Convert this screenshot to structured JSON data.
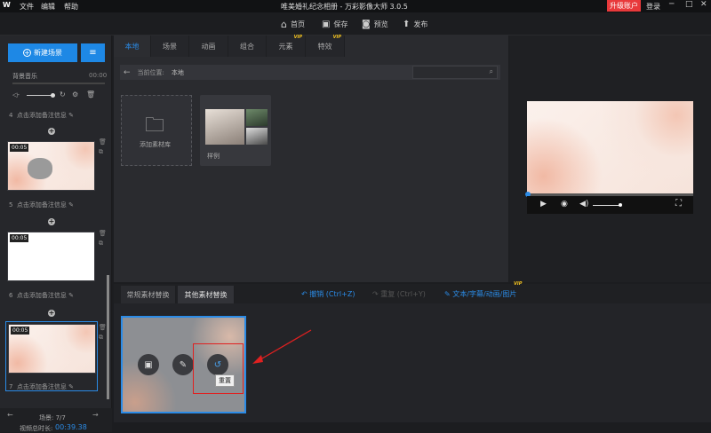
{
  "app": {
    "title": "唯美婚礼纪念相册 - 万彩影像大师 3.0.5",
    "logo": "W",
    "menu": [
      "文件",
      "编辑",
      "帮助"
    ],
    "upgrade": "升级账户",
    "login": "登录"
  },
  "toolbar": {
    "home": "首页",
    "save": "保存",
    "preview": "预览",
    "publish": "发布"
  },
  "left": {
    "new_scene": "新建场景",
    "bgm_label": "背景音乐",
    "bgm_time": "00:00",
    "scenes": [
      {
        "index": "4",
        "note": "点击添加备注信息"
      },
      {
        "index": "5",
        "note": "点击添加备注信息",
        "dur": "00:05"
      },
      {
        "index": "6",
        "note": "点击添加备注信息",
        "dur": "00:05"
      },
      {
        "index": "7",
        "note": "点击添加备注信息",
        "dur": "00:05"
      }
    ],
    "scene_count": "场景: 7/7",
    "total_duration_label": "视频总时长:",
    "total_duration": "00:39.38"
  },
  "library": {
    "tabs": [
      "本地",
      "场景",
      "动画",
      "组合",
      "元素",
      "特效"
    ],
    "tab_vip": [
      "VIP",
      "VIP"
    ],
    "location_label": "当前位置:",
    "location_value": "本地",
    "add_library": "添加素材库",
    "sample": "样例"
  },
  "bottom": {
    "tabs": [
      "常规素材替换",
      "其他素材替换"
    ],
    "undo": "撤销 (Ctrl+Z)",
    "redo": "重复 (Ctrl+Y)",
    "text_link": "文本/字幕/动画/图片",
    "vip": "VIP",
    "tooltip": "重置"
  }
}
